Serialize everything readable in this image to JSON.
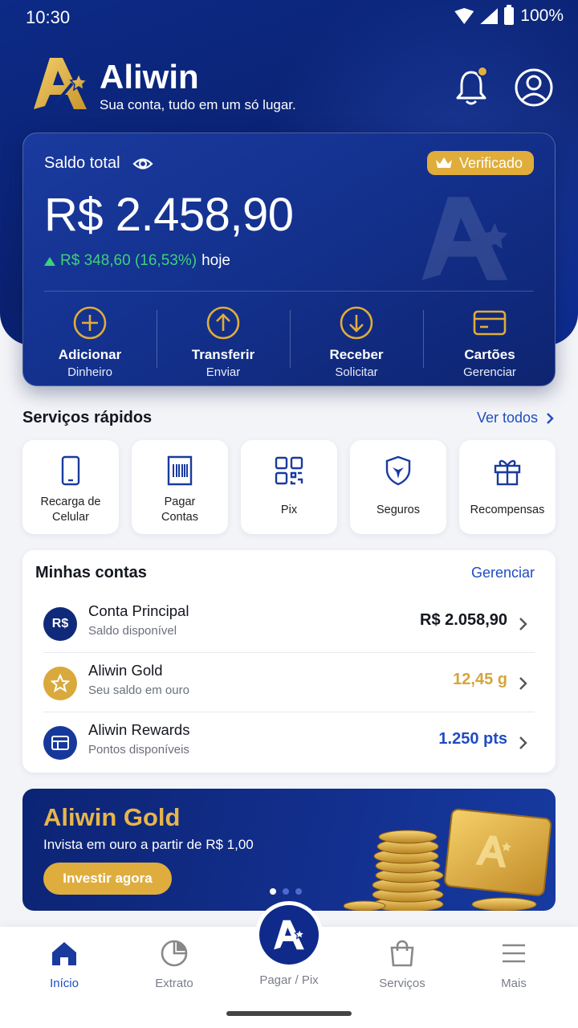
{
  "status_bar": {
    "time": "10:30",
    "battery": "100%",
    "icons": [
      "wifi-icon",
      "signal-icon",
      "battery-icon"
    ]
  },
  "header": {
    "brand": "Aliwin",
    "tagline": "Sua conta, tudo em um só lugar.",
    "icons": [
      "bell-icon",
      "profile-icon"
    ]
  },
  "balance": {
    "label": "Saldo total",
    "badge": "Verificado",
    "amount": "R$ 2.458,90",
    "change": "R$ 348,60 (16,53%)",
    "change_suffix": "hoje",
    "actions": [
      {
        "title": "Adicionar",
        "subtitle": "Dinheiro",
        "icon": "plus-circle-icon"
      },
      {
        "title": "Transferir",
        "subtitle": "Enviar",
        "icon": "arrow-up-circle-icon"
      },
      {
        "title": "Receber",
        "subtitle": "Solicitar",
        "icon": "arrow-down-circle-icon"
      },
      {
        "title": "Cartões",
        "subtitle": "Gerenciar",
        "icon": "card-icon"
      }
    ]
  },
  "quick_services": {
    "title": "Serviços rápidos",
    "see_all": "Ver todos",
    "items": [
      {
        "line1": "Recarga de",
        "line2": "Celular",
        "icon": "phone-icon"
      },
      {
        "line1": "Pagar",
        "line2": "Contas",
        "icon": "barcode-bill-icon"
      },
      {
        "line1": "Pix",
        "line2": "",
        "icon": "qr-code-icon"
      },
      {
        "line1": "Seguros",
        "line2": "",
        "icon": "shield-icon"
      },
      {
        "line1": "Recompensas",
        "line2": "",
        "icon": "gift-icon"
      }
    ]
  },
  "accounts": {
    "title": "Minhas contas",
    "manage": "Gerenciar",
    "items": [
      {
        "avatar_text": "R$",
        "name": "Conta Principal",
        "sub": "Saldo disponível",
        "value": "R$ 2.058,90",
        "value_color": "#14171f",
        "avatar_color": "#0f2a7a"
      },
      {
        "avatar_text": "",
        "name": "Aliwin Gold",
        "sub": "Seu saldo em ouro",
        "value": "12,45 g",
        "value_color": "#d6a53a",
        "avatar_color": "#d9a93c"
      },
      {
        "avatar_text": "",
        "name": "Aliwin Rewards",
        "sub": "Pontos disponíveis",
        "value": "1.250 pts",
        "value_color": "#1f4cc2",
        "avatar_color": "#16389a"
      }
    ]
  },
  "promo": {
    "title": "Aliwin Gold",
    "subtitle": "Invista em ouro a partir de R$ 1,00",
    "button": "Investir agora",
    "slides": 3,
    "active_slide": 1
  },
  "bottom_nav": {
    "items": [
      {
        "label": "Início",
        "icon": "home-icon",
        "active": true
      },
      {
        "label": "Extrato",
        "icon": "pie-chart-icon",
        "active": false
      },
      {
        "label": "Pagar / Pix",
        "icon": "aliwin-logo-icon",
        "active": false
      },
      {
        "label": "Serviços",
        "icon": "shopping-bag-icon",
        "active": false
      },
      {
        "label": "Mais",
        "icon": "menu-icon",
        "active": false
      }
    ]
  },
  "colors": {
    "primary": "#0c2a86",
    "gold": "#e0ad3a",
    "positive": "#3ed07a",
    "link": "#1f4cc2"
  }
}
